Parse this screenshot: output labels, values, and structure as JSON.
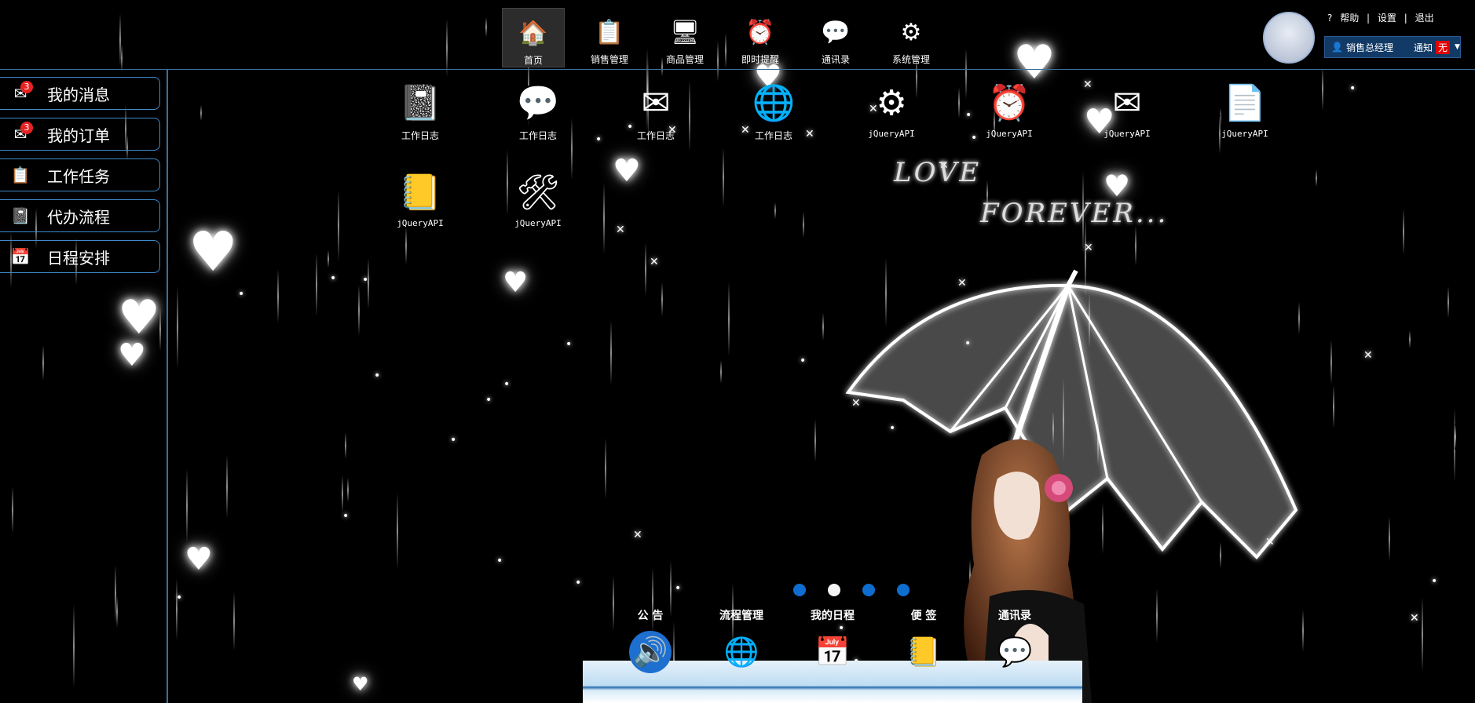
{
  "top_nav": {
    "items": [
      {
        "label": "首页",
        "icon": "home-icon",
        "glyph": "🏠"
      },
      {
        "label": "销售管理",
        "icon": "clipboard-icon",
        "glyph": "📋"
      },
      {
        "label": "商品管理",
        "icon": "computer-icon",
        "glyph": "🖥"
      },
      {
        "label": "即时提醒",
        "icon": "clock-icon",
        "glyph": "⏰"
      },
      {
        "label": "通讯录",
        "icon": "chat-icon",
        "glyph": "💬"
      },
      {
        "label": "系统管理",
        "icon": "gear-icon",
        "glyph": "⚙"
      }
    ]
  },
  "header": {
    "help": "帮助",
    "settings": "设置",
    "logout": "退出",
    "user": "销售总经理",
    "notice_label": "通知",
    "notice_value": "无"
  },
  "sidebar": {
    "items": [
      {
        "label": "我的消息",
        "icon": "mail-icon",
        "glyph": "✉",
        "badge": "3"
      },
      {
        "label": "我的订单",
        "icon": "mail-icon",
        "glyph": "✉",
        "badge": "3"
      },
      {
        "label": "工作任务",
        "icon": "clipboard-icon",
        "glyph": "📋"
      },
      {
        "label": "代办流程",
        "icon": "notebook-icon",
        "glyph": "📓"
      },
      {
        "label": "日程安排",
        "icon": "calendar-icon",
        "glyph": "📅"
      }
    ]
  },
  "desktop": {
    "icons": [
      {
        "label": "工作日志",
        "icon": "notebook-icon",
        "glyph": "📓"
      },
      {
        "label": "工作日志",
        "icon": "chat-icon",
        "glyph": "💬"
      },
      {
        "label": "工作日志",
        "icon": "envelope-icon",
        "glyph": "✉"
      },
      {
        "label": "工作日志",
        "icon": "globe-icon",
        "glyph": "🌐"
      },
      {
        "label": "jQueryAPI",
        "icon": "gear-icon",
        "glyph": "⚙"
      },
      {
        "label": "jQueryAPI",
        "icon": "clock-icon",
        "glyph": "⏰"
      },
      {
        "label": "jQueryAPI",
        "icon": "mail-icon",
        "glyph": "✉"
      },
      {
        "label": "jQueryAPI",
        "icon": "document-icon",
        "glyph": "📄"
      },
      {
        "label": "jQueryAPI",
        "icon": "notepad-icon",
        "glyph": "📒"
      },
      {
        "label": "jQueryAPI",
        "icon": "tools-icon",
        "glyph": "🛠"
      }
    ]
  },
  "wallpaper": {
    "text1": "LOVE",
    "text2": "FOREVER..."
  },
  "dock": {
    "items": [
      {
        "label": "公 告",
        "icon": "speaker-icon",
        "glyph": "🔊",
        "bg": "#1d6fd0"
      },
      {
        "label": "流程管理",
        "icon": "globe-icon",
        "glyph": "🌐",
        "bg": "#000000"
      },
      {
        "label": "我的日程",
        "icon": "calendar-icon",
        "glyph": "📅",
        "bg": "#000000"
      },
      {
        "label": "便 签",
        "icon": "notepad-icon",
        "glyph": "📒",
        "bg": "#000000"
      },
      {
        "label": "通讯录",
        "icon": "chat-icon",
        "glyph": "💬",
        "bg": "#000000"
      }
    ]
  },
  "pager": {
    "count": 4,
    "active": 1
  }
}
